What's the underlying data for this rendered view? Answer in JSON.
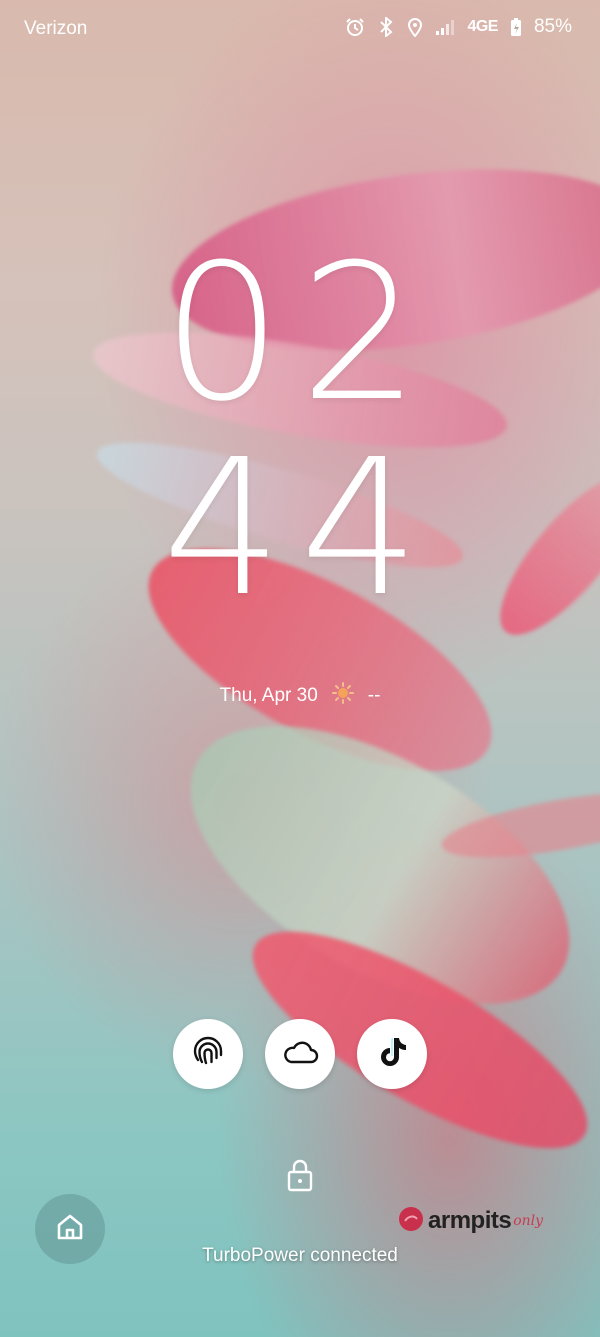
{
  "status_bar": {
    "carrier": "Verizon",
    "network": "4GE",
    "battery_percent": "85%",
    "icons": [
      "alarm-icon",
      "bluetooth-icon",
      "location-icon",
      "signal-icon",
      "battery-charging-icon"
    ]
  },
  "clock": {
    "hours": "02",
    "minutes": "44"
  },
  "date_weather": {
    "date": "Thu, Apr 30",
    "weather_icon": "sun-icon",
    "temperature": "--"
  },
  "shortcuts": [
    {
      "name": "life360-shortcut",
      "icon": "fingerprint-rings-icon"
    },
    {
      "name": "weather-shortcut",
      "icon": "cloud-icon"
    },
    {
      "name": "tiktok-shortcut",
      "icon": "tiktok-note-icon"
    }
  ],
  "lock_icon": "padlock-icon",
  "home_button_icon": "home-icon",
  "charging_status": "TurboPower connected",
  "watermark": {
    "word": "armpits",
    "script": "only"
  },
  "colors": {
    "accent_pink": "#e0628a",
    "teal_bottom": "#7fc3bf",
    "watermark_red": "#c83d53"
  }
}
